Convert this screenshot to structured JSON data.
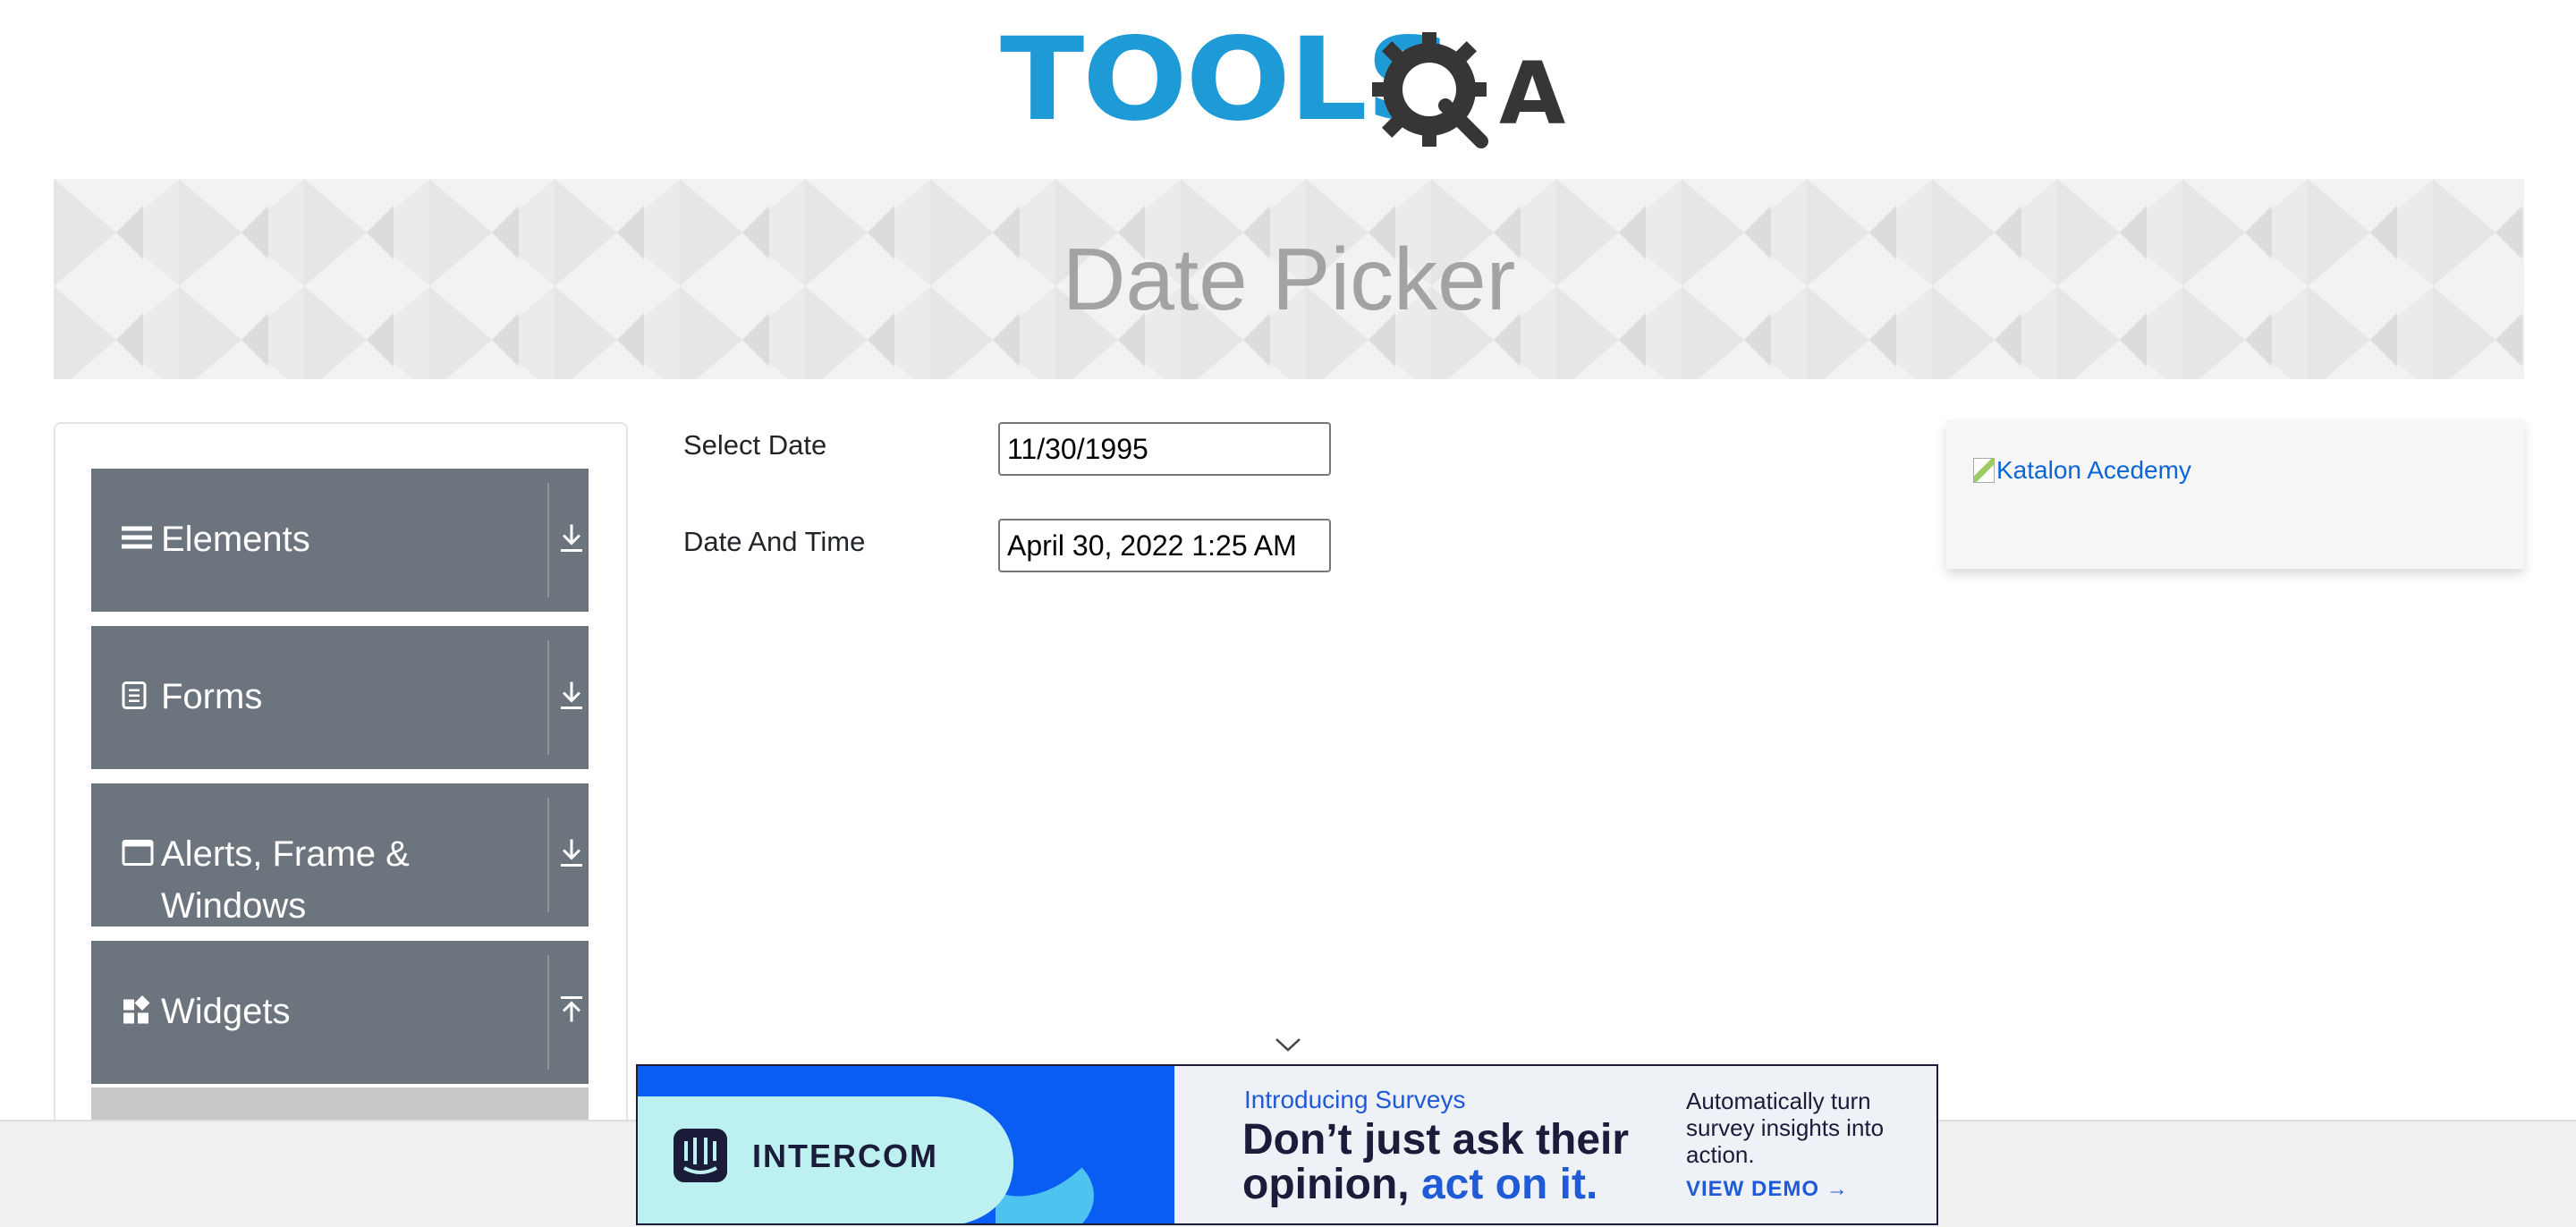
{
  "logo": {
    "text": "TOOLS",
    "suffix": "A",
    "brand_color": "#1e9ad6",
    "gear_color": "#363636"
  },
  "banner": {
    "title": "Date Picker"
  },
  "sidebar": {
    "groups": [
      {
        "label": "Elements",
        "icon": "hamburger-icon",
        "arrow": "download-arrow-icon"
      },
      {
        "label": "Forms",
        "icon": "document-icon",
        "arrow": "download-arrow-icon"
      },
      {
        "label_line1": "Alerts, Frame &",
        "label_line2": "Windows",
        "icon": "window-icon",
        "arrow": "download-arrow-icon"
      },
      {
        "label": "Widgets",
        "icon": "widgets-icon",
        "arrow": "upload-arrow-icon"
      }
    ]
  },
  "form": {
    "select_date": {
      "label": "Select Date",
      "value": "11/30/1995"
    },
    "date_time": {
      "label": "Date And Time",
      "value": "April 30, 2022 1:25 AM"
    }
  },
  "right_ad": {
    "alt_text": "Katalon Acedemy"
  },
  "bottom_ad": {
    "brand": "INTERCOM",
    "intro": "Introducing Surveys",
    "headline_part1": "Don’t just ask their opinion, ",
    "headline_accent": "act on it.",
    "sub": "Automatically turn survey insights into action.",
    "cta": "VIEW DEMO"
  },
  "colors": {
    "sidebar_group_bg": "#6c757d",
    "link": "#0a66d8",
    "ad_accent": "#1f5bd6"
  }
}
